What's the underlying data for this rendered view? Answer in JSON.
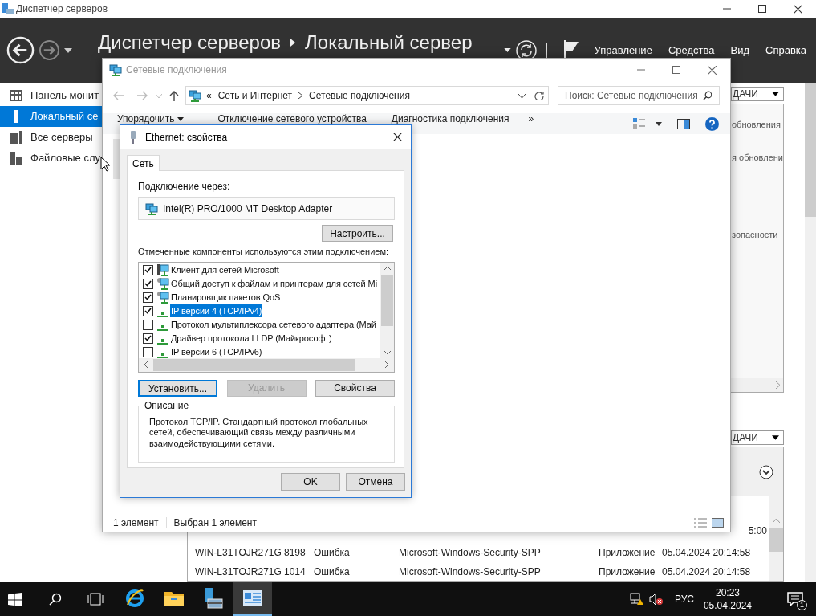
{
  "server_manager": {
    "window_title": "Диспетчер серверов",
    "breadcrumb": [
      "Диспетчер серверов",
      "Локальный сервер"
    ],
    "menu": [
      "Управление",
      "Средства",
      "Вид",
      "Справка"
    ],
    "sidebar": [
      {
        "label": "Панель монит",
        "kind": "dashboard",
        "selected": false
      },
      {
        "label": "Локальный се",
        "kind": "server",
        "selected": true
      },
      {
        "label": "Все серверы",
        "kind": "servers",
        "selected": false
      },
      {
        "label": "Файловые слу",
        "kind": "files",
        "selected": false
      }
    ],
    "properties_panel": {
      "tasks_label": "ДАЧИ",
      "lines": [
        "обновления",
        "я обновлени",
        "зопасности"
      ]
    },
    "events_panel": {
      "tasks_label": "ДАЧИ",
      "partial_time": "5:00",
      "rows": [
        {
          "cells": [
            "WIN-L31TOJR271G",
            "8198",
            "Ошибка",
            "Microsoft-Windows-Security-SPP",
            "Приложение",
            "05.04.2024 20:14:58"
          ]
        },
        {
          "cells": [
            "WIN-L31TOJR271G",
            "1014",
            "Ошибка",
            "Microsoft-Windows-Security-SPP",
            "Приложение",
            "05.04.2024 20:14:58"
          ]
        }
      ]
    }
  },
  "network_window": {
    "title": "Сетевые подключения",
    "path_prefix": "«",
    "path": [
      "Сеть и Интернет",
      "Сетевые подключения"
    ],
    "search": {
      "placeholder": "Поиск: Сетевые подключения"
    },
    "toolbar": [
      {
        "label": "Упорядочить",
        "kind": "menu"
      },
      {
        "label": "Отключение сетевого устройства",
        "kind": "command"
      },
      {
        "label": "Диагностика подключения",
        "kind": "command"
      },
      {
        "label": "»",
        "kind": "more"
      }
    ],
    "status": [
      "1 элемент",
      "Выбран 1 элемент"
    ]
  },
  "dialog": {
    "title": "Ethernet: свойства",
    "tabs": [
      {
        "label": "Сеть",
        "selected": true
      }
    ],
    "connect_label": "Подключение через:",
    "adapter": "Intel(R) PRO/1000 MT Desktop Adapter",
    "configure_button": "Настроить...",
    "components_label": "Отмеченные компоненты используются этим подключением:",
    "components": [
      {
        "label": "Клиент для сетей Microsoft",
        "kind": "client",
        "checked": true,
        "selected": false
      },
      {
        "label": "Общий доступ к файлам и принтерам для сетей Mi",
        "kind": "service",
        "checked": true,
        "selected": false
      },
      {
        "label": "Планировщик пакетов QoS",
        "kind": "service",
        "checked": true,
        "selected": false
      },
      {
        "label": "IP версии 4 (TCP/IPv4)",
        "kind": "protocol",
        "checked": true,
        "selected": true
      },
      {
        "label": "Протокол мультиплексора сетевого адаптера (Май",
        "kind": "protocol",
        "checked": false,
        "selected": false
      },
      {
        "label": "Драйвер протокола LLDP (Майкрософт)",
        "kind": "protocol",
        "checked": true,
        "selected": false
      },
      {
        "label": "IP версии 6 (TCP/IPv6)",
        "kind": "protocol",
        "checked": false,
        "selected": false
      }
    ],
    "buttons": [
      {
        "label": "Установить...",
        "disabled": false,
        "focused": true
      },
      {
        "label": "Удалить",
        "disabled": true,
        "focused": false
      },
      {
        "label": "Свойства",
        "disabled": false,
        "focused": false
      }
    ],
    "description": {
      "legend": "Описание",
      "text": "Протокол TCP/IP. Стандартный протокол глобальных сетей, обеспечивающий связь между различными взаимодействующими сетями."
    },
    "footer_buttons": [
      "OK",
      "Отмена"
    ]
  },
  "taskbar": {
    "apps": [
      {
        "kind": "ie",
        "selected": false
      },
      {
        "kind": "explorer",
        "selected": false
      },
      {
        "kind": "server-manager",
        "selected": false
      },
      {
        "kind": "network",
        "selected": true
      }
    ],
    "language": "РУС",
    "time": "20:23",
    "date": "05.04.2024",
    "notifications": "1"
  }
}
